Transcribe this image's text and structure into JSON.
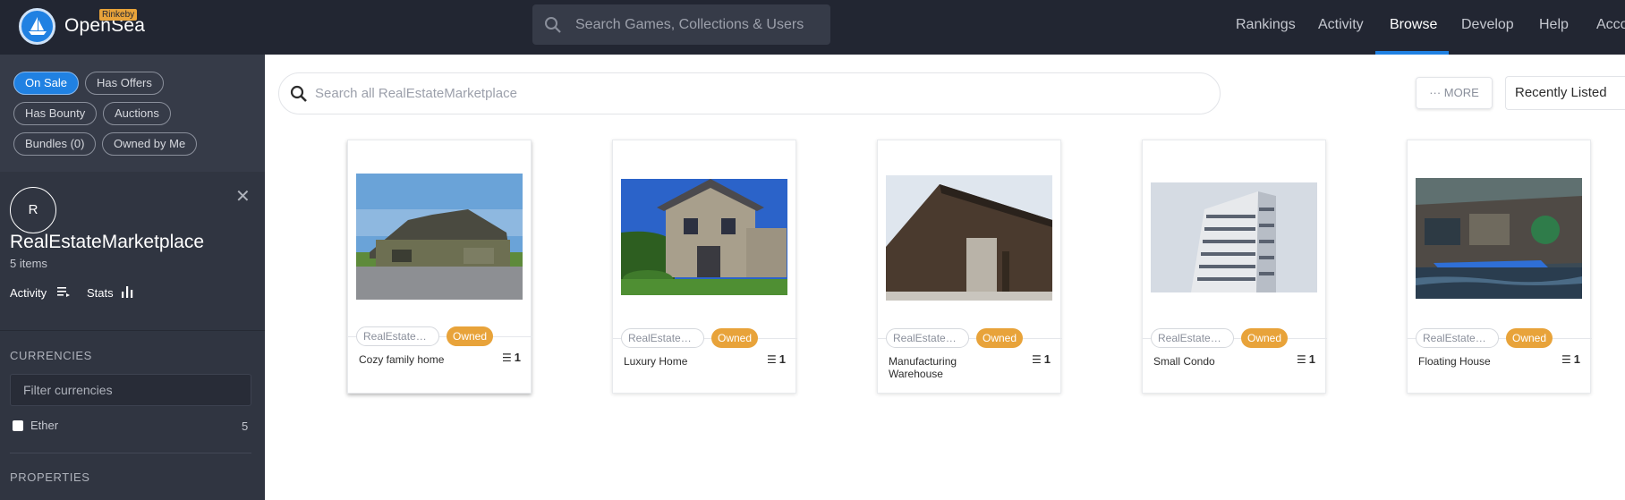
{
  "header": {
    "brand": "OpenSea",
    "network_badge": "Rinkeby",
    "search_placeholder": "Search Games, Collections & Users",
    "nav": [
      {
        "label": "Rankings",
        "active": false
      },
      {
        "label": "Activity",
        "active": false
      },
      {
        "label": "Browse",
        "active": true
      },
      {
        "label": "Develop",
        "active": false
      },
      {
        "label": "Help",
        "active": false
      },
      {
        "label": "Acco",
        "active": false
      }
    ]
  },
  "sidebar": {
    "filters": [
      {
        "label": "On Sale",
        "active": true
      },
      {
        "label": "Has Offers",
        "active": false
      },
      {
        "label": "Has Bounty",
        "active": false
      },
      {
        "label": "Auctions",
        "active": false
      },
      {
        "label": "Bundles (0)",
        "active": false
      },
      {
        "label": "Owned by Me",
        "active": false
      }
    ],
    "collection": {
      "avatar_letter": "R",
      "name": "RealEstateMarketplace",
      "item_count": "5 items",
      "close_icon": "close-icon"
    },
    "tabs": [
      {
        "label": "Activity",
        "icon": "list-icon"
      },
      {
        "label": "Stats",
        "icon": "bar-chart-icon"
      }
    ],
    "currencies": {
      "header": "CURRENCIES",
      "filter_placeholder": "Filter currencies",
      "options": [
        {
          "label": "Ether",
          "count": "5",
          "checked": false
        }
      ]
    },
    "properties_header": "PROPERTIES"
  },
  "main": {
    "search_placeholder": "Search all RealEstateMarketplace",
    "more_button": "··· MORE",
    "sort_value": "Recently Listed",
    "cards": [
      {
        "collection": "RealEstate…",
        "badge": "Owned",
        "name": "Cozy family home",
        "quantity": "1"
      },
      {
        "collection": "RealEstate…",
        "badge": "Owned",
        "name": "Luxury Home",
        "quantity": "1"
      },
      {
        "collection": "RealEstate…",
        "badge": "Owned",
        "name": "Manufacturing Warehouse",
        "quantity": "1"
      },
      {
        "collection": "RealEstate…",
        "badge": "Owned",
        "name": "Small Condo",
        "quantity": "1"
      },
      {
        "collection": "RealEstate…",
        "badge": "Owned",
        "name": "Floating House",
        "quantity": "1"
      }
    ]
  },
  "colors": {
    "nav_bg": "#222632",
    "sidebar_bg": "#303541",
    "accent_blue": "#2081e2",
    "owned_orange": "#e8a33a"
  }
}
